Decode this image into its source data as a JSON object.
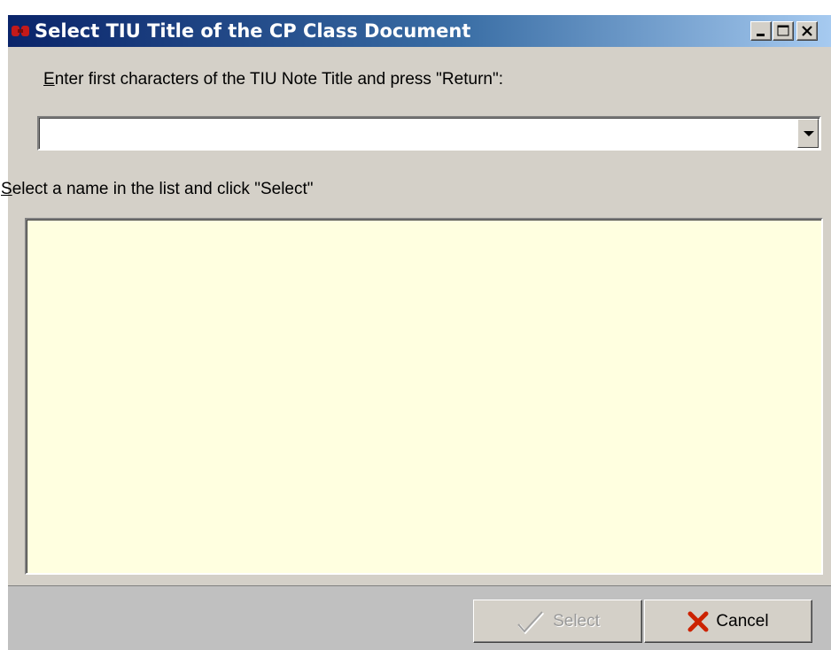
{
  "window": {
    "title": "Select TIU Title of the CP Class Document"
  },
  "prompt": {
    "first_char": "E",
    "rest": "nter first characters of the TIU Note Title and press \"Return\":"
  },
  "combo": {
    "value": "",
    "icon": "chevron-down-icon"
  },
  "list_prompt": {
    "first_char": "S",
    "rest": "elect a name in the list and click \"Select\""
  },
  "list": {
    "items": [],
    "background": "#ffffe0"
  },
  "buttons": {
    "select_label": "Select",
    "select_enabled": false,
    "cancel_label": "Cancel"
  },
  "colors": {
    "titlebar_start": "#0a246a",
    "titlebar_end": "#a6caf0",
    "face": "#d4d0c8",
    "cancel_x": "#cc2200"
  }
}
